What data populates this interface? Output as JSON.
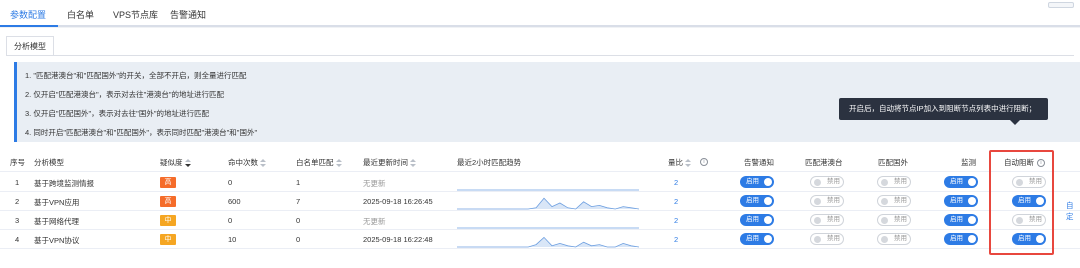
{
  "top_tabs": [
    {
      "label": "参数配置",
      "active": true
    },
    {
      "label": "白名单",
      "active": false
    },
    {
      "label": "VPS节点库",
      "active": false
    },
    {
      "label": "告警通知",
      "active": false
    }
  ],
  "sub_tab": "分析模型",
  "info_lines": [
    "1. \"匹配港澳台\"和\"匹配国外\"的开关，全部不开启，则全量进行匹配",
    "2. 仅开启\"匹配港澳台\"，表示对去往\"港澳台\"的地址进行匹配",
    "3. 仅开启\"匹配国外\"，表示对去往\"国外\"的地址进行匹配",
    "4. 同时开启\"匹配港澳台\"和\"匹配国外\"，表示同时匹配\"港澳台\"和\"国外\""
  ],
  "tooltip": "开启后，自动将节点IP加入到阻断节点列表中进行阻断；",
  "columns": {
    "index": "序号",
    "model": "分析模型",
    "suspicion": "疑似度",
    "hits": "命中次数",
    "whitelist": "白名单匹配",
    "last_update": "最近更新时间",
    "trend": "最近2小时匹配趋势",
    "quantity": "量比",
    "alert": "告警通知",
    "hk": "匹配港澳台",
    "foreign": "匹配国外",
    "monitor": "监测",
    "auto_block": "自动阻断"
  },
  "rows": [
    {
      "index": "1",
      "model": "基于跨境监测情报",
      "level": "高",
      "level_color": "#f56c2a",
      "hits": "0",
      "whitelist": "1",
      "last_update": "无更新",
      "updated": false,
      "quantity": "2",
      "alert": "启用",
      "hk": "禁用",
      "foreign": "禁用",
      "monitor": "启用",
      "auto_block": "禁用",
      "trend": [
        0,
        0,
        0,
        0,
        0,
        0,
        0,
        0,
        0,
        0,
        0,
        0,
        0,
        0,
        0,
        0,
        0,
        0,
        0,
        0,
        0,
        0,
        0,
        0
      ]
    },
    {
      "index": "2",
      "model": "基于VPN应用",
      "level": "高",
      "level_color": "#f56c2a",
      "hits": "600",
      "whitelist": "7",
      "last_update": "2025-09-18 16:26:45",
      "updated": true,
      "quantity": "2",
      "alert": "启用",
      "hk": "禁用",
      "foreign": "禁用",
      "monitor": "启用",
      "auto_block": "启用",
      "trend": [
        0,
        0,
        0,
        0,
        0,
        0,
        0,
        0,
        0,
        0,
        0.1,
        0.9,
        0.2,
        0.5,
        0.1,
        0,
        0.6,
        0.2,
        0.3,
        0.1,
        0,
        0.2,
        0.1,
        0
      ]
    },
    {
      "index": "3",
      "model": "基于网络代理",
      "level": "中",
      "level_color": "#f5a623",
      "hits": "0",
      "whitelist": "0",
      "last_update": "无更新",
      "updated": false,
      "quantity": "2",
      "alert": "启用",
      "hk": "禁用",
      "foreign": "禁用",
      "monitor": "启用",
      "auto_block": "禁用",
      "trend": [
        0,
        0,
        0,
        0,
        0,
        0,
        0,
        0,
        0,
        0,
        0,
        0,
        0,
        0,
        0,
        0,
        0,
        0,
        0,
        0,
        0,
        0,
        0,
        0
      ]
    },
    {
      "index": "4",
      "model": "基于VPN协议",
      "level": "中",
      "level_color": "#f5a623",
      "hits": "10",
      "whitelist": "0",
      "last_update": "2025-09-18 16:22:48",
      "updated": true,
      "quantity": "2",
      "alert": "启用",
      "hk": "禁用",
      "foreign": "禁用",
      "monitor": "启用",
      "auto_block": "启用",
      "trend": [
        0,
        0,
        0,
        0,
        0,
        0,
        0,
        0,
        0,
        0,
        0.2,
        0.8,
        0.1,
        0.3,
        0.1,
        0,
        0.4,
        0.1,
        0.2,
        0,
        0,
        0.3,
        0.1,
        0
      ]
    }
  ],
  "cut_label": "自定",
  "colors": {
    "accent": "#2d7be5",
    "tooltip_bg": "#2b3240",
    "highlight": "#e8473e"
  }
}
